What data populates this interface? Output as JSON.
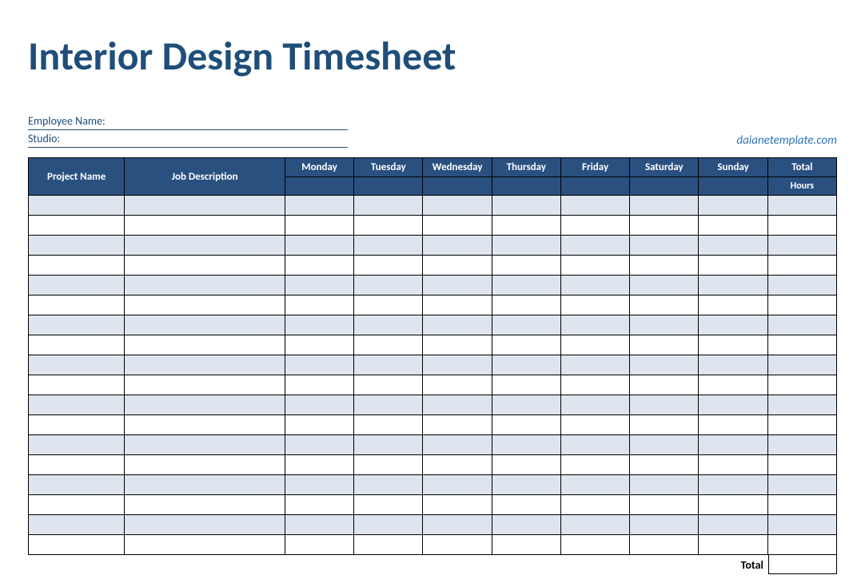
{
  "title": "Interior Design Timesheet",
  "fields": {
    "employee_label": "Employee Name:",
    "employee_value": "",
    "studio_label": "Studio:",
    "studio_value": ""
  },
  "watermark": "daianetemplate.com",
  "headers": {
    "project": "Project Name",
    "job": "Job Description",
    "days": [
      "Monday",
      "Tuesday",
      "Wednesday",
      "Thursday",
      "Friday",
      "Saturday",
      "Sunday"
    ],
    "total": "Total",
    "total_sub": "Hours"
  },
  "row_count": 18,
  "footer": {
    "total_label": "Total",
    "total_value": ""
  }
}
